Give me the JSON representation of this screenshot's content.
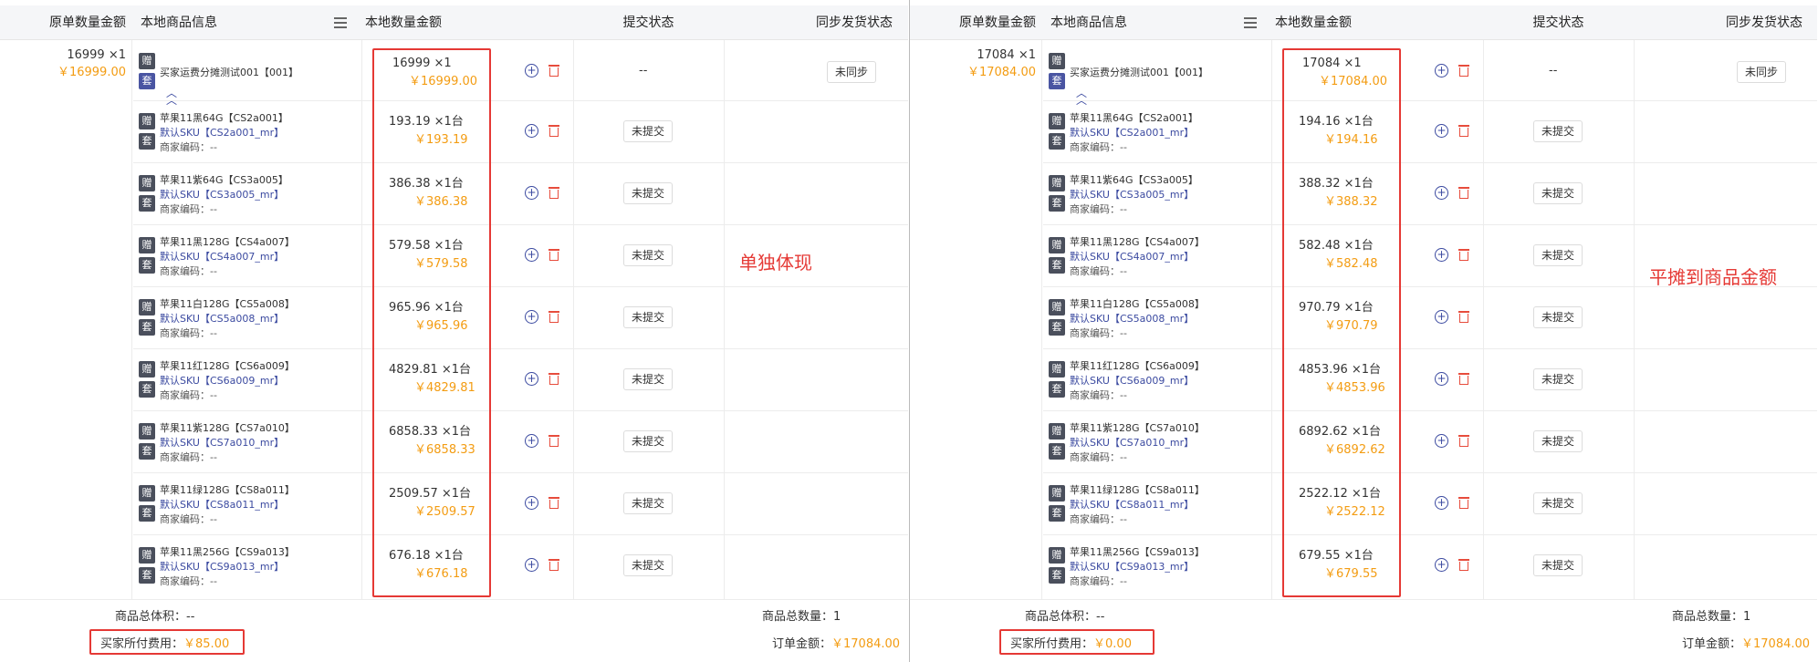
{
  "headers": {
    "orig": "原单数量金额",
    "info": "本地商品信息",
    "qty": "本地数量金额",
    "submit": "提交状态",
    "sync": "同步发货状态"
  },
  "badges": {
    "gift": "赠",
    "set": "套"
  },
  "common": {
    "main_name": "买家运费分摊测试001【001】",
    "not_synced": "未同步",
    "not_submitted": "未提交",
    "dashes": "--",
    "total_volume_label": "商品总体积：--",
    "total_qty_label": "商品总数量：1",
    "buyer_fee_label": "买家所付费用：",
    "order_amount_label": "订单金额：",
    "order_amount": "￥17084.00"
  },
  "items": [
    {
      "name": "苹果11黑64G【CS2a001】",
      "sku": "默认SKU【CS2a001_mr】",
      "code": "商家编码：--"
    },
    {
      "name": "苹果11紫64G【CS3a005】",
      "sku": "默认SKU【CS3a005_mr】",
      "code": "商家编码：--"
    },
    {
      "name": "苹果11黑128G【CS4a007】",
      "sku": "默认SKU【CS4a007_mr】",
      "code": "商家编码：--"
    },
    {
      "name": "苹果11白128G【CS5a008】",
      "sku": "默认SKU【CS5a008_mr】",
      "code": "商家编码：--"
    },
    {
      "name": "苹果11红128G【CS6a009】",
      "sku": "默认SKU【CS6a009_mr】",
      "code": "商家编码：--"
    },
    {
      "name": "苹果11紫128G【CS7a010】",
      "sku": "默认SKU【CS7a010_mr】",
      "code": "商家编码：--"
    },
    {
      "name": "苹果11绿128G【CS8a011】",
      "sku": "默认SKU【CS8a011_mr】",
      "code": "商家编码：--"
    },
    {
      "name": "苹果11黑256G【CS9a013】",
      "sku": "默认SKU【CS9a013_mr】",
      "code": "商家编码：--"
    }
  ],
  "left": {
    "orig_qty": "16999 ×1",
    "orig_amount": "￥16999.00",
    "main_qty": "16999 ×1",
    "main_amount": "￥16999.00",
    "item_qty": [
      "193.19 ×1台",
      "386.38 ×1台",
      "579.58 ×1台",
      "965.96 ×1台",
      "4829.81 ×1台",
      "6858.33 ×1台",
      "2509.57 ×1台",
      "676.18 ×1台"
    ],
    "item_amount": [
      "￥193.19",
      "￥386.38",
      "￥579.58",
      "￥965.96",
      "￥4829.81",
      "￥6858.33",
      "￥2509.57",
      "￥676.18"
    ],
    "annotation": "单独体现",
    "buyer_fee": "￥85.00"
  },
  "right": {
    "orig_qty": "17084 ×1",
    "orig_amount": "￥17084.00",
    "main_qty": "17084 ×1",
    "main_amount": "￥17084.00",
    "item_qty": [
      "194.16 ×1台",
      "388.32 ×1台",
      "582.48 ×1台",
      "970.79 ×1台",
      "4853.96 ×1台",
      "6892.62 ×1台",
      "2522.12 ×1台",
      "679.55 ×1台"
    ],
    "item_amount": [
      "￥194.16",
      "￥388.32",
      "￥582.48",
      "￥970.79",
      "￥4853.96",
      "￥6892.62",
      "￥2522.12",
      "￥679.55"
    ],
    "annotation": "平摊到商品金额",
    "buyer_fee": "￥0.00"
  },
  "colors": {
    "accent_orange": "#f39c12",
    "link_blue": "#3b4aa0",
    "highlight_red": "#e53935"
  }
}
